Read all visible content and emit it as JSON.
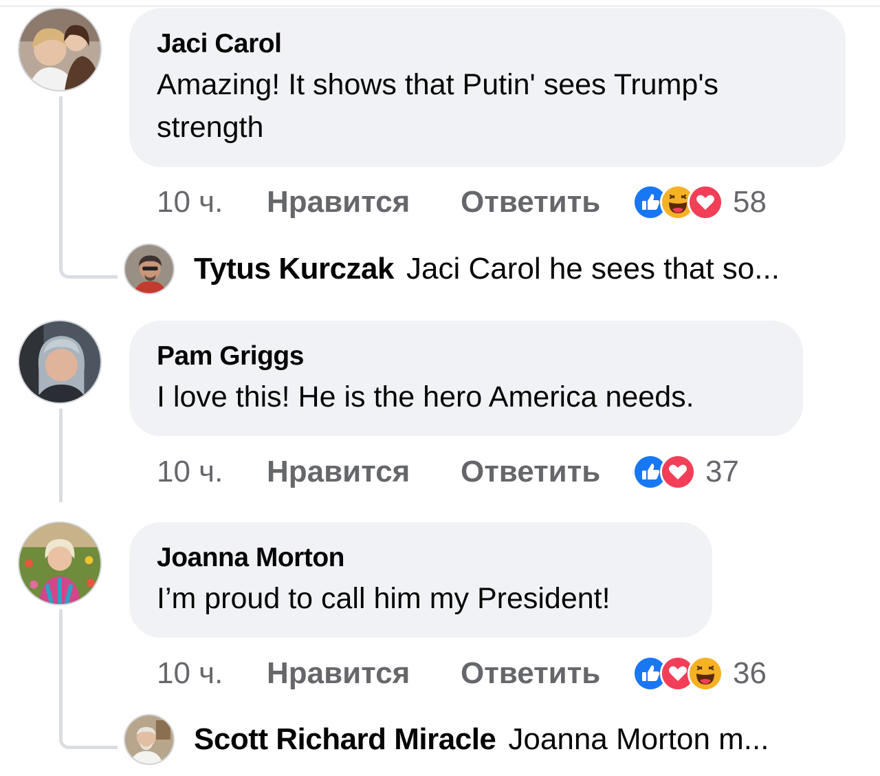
{
  "comments": [
    {
      "author": "Jaci Carol",
      "text_lines": [
        "Amazing!  It shows that Putin' sees Trump's",
        "strength"
      ],
      "time": "10 ч.",
      "like_label": "Нравится",
      "reply_label": "Ответить",
      "reactions": [
        "like",
        "haha",
        "love"
      ],
      "reaction_count": "58",
      "reply": {
        "author": "Tytus Kurczak",
        "preview": "Jaci Carol he sees that so..."
      }
    },
    {
      "author": "Pam Griggs",
      "text_lines": [
        "I love this! He is the hero America needs."
      ],
      "time": "10 ч.",
      "like_label": "Нравится",
      "reply_label": "Ответить",
      "reactions": [
        "like",
        "love"
      ],
      "reaction_count": "37"
    },
    {
      "author": "Joanna Morton",
      "text_lines": [
        "I’m proud to call him my President!"
      ],
      "time": "10 ч.",
      "like_label": "Нравится",
      "reply_label": "Ответить",
      "reactions": [
        "like",
        "love",
        "haha"
      ],
      "reaction_count": "36",
      "reply": {
        "author": "Scott Richard Miracle",
        "preview": "Joanna Morton m..."
      }
    }
  ],
  "colors": {
    "bubble": "#f0f2f5",
    "meta_text": "#65676b",
    "like_blue": "#1877f2",
    "love_red": "#f33e58",
    "haha_yellow": "#f7b125"
  }
}
